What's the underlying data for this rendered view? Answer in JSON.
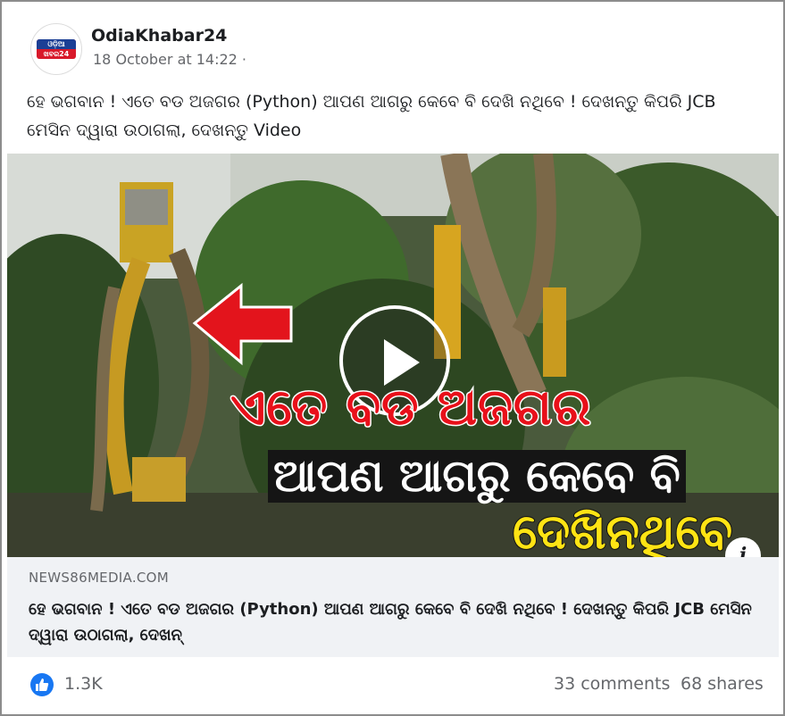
{
  "post": {
    "page_name": "OdiaKhabar24",
    "timestamp": "18 October at 14:22 ·",
    "avatar_text_top": "ଓଡ଼ିଆ",
    "avatar_text_bottom": "ଖବର24",
    "caption": "ହେ ଭଗବାନ ! ଏତେ ବଡ ଅଜଗର (Python) ଆପଣ ଆଗରୁ କେବେ ବି ଦେଖି ନଥିବେ ! ଦେଖନ୍ତୁ କିପରି JCB ମେସିନ ଦ୍ୱାରା ଉଠାଗଲା, ଦେଖନ୍ତୁ Video"
  },
  "video": {
    "overlay_line1": "ଏତେ ବଡ ଅଜଗର",
    "overlay_line2": "ଆପଣ ଆଗରୁ କେବେ ବି",
    "overlay_line3": "ଦେଖିନଥିବେ",
    "play_icon": "play-icon",
    "info_icon": "info-icon",
    "info_glyph": "i"
  },
  "link_preview": {
    "domain": "NEWS86MEDIA.COM",
    "title": "ହେ ଭଗବାନ ! ଏତେ ବଡ ଅଜଗର (Python) ଆପଣ ଆଗରୁ କେବେ ବି ଦେଖି ନଥିବେ ! ଦେଖନ୍ତୁ କିପରି JCB ମେସିନ ଦ୍ୱାରା ଉଠାଗଲା, ଦେଖନ୍"
  },
  "stats": {
    "reactions": "1.3K",
    "comments": "33 comments",
    "shares": "68 shares",
    "like_color": "#1877f2"
  }
}
